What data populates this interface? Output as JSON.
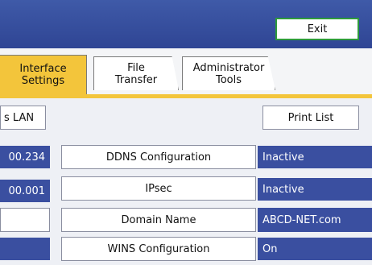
{
  "header": {
    "exit_label": "Exit"
  },
  "tabs": [
    {
      "label_line1": "Interface",
      "label_line2": "Settings"
    },
    {
      "label_line1": "File",
      "label_line2": "Transfer"
    },
    {
      "label_line1": "Administrator",
      "label_line2": "Tools"
    }
  ],
  "left_column": {
    "lan_button": "s LAN",
    "value1": "00.234",
    "value2": "00.001"
  },
  "print_list_label": "Print List",
  "rows": [
    {
      "label": "DDNS Configuration",
      "value": "Inactive"
    },
    {
      "label": "IPsec",
      "value": "Inactive"
    },
    {
      "label": "Domain Name",
      "value": "ABCD-NET.com"
    },
    {
      "label": "WINS Configuration",
      "value": "On"
    }
  ],
  "colors": {
    "accent": "#f3c53b",
    "header": "#2f4594",
    "value_bg": "#3a4fa0",
    "exit_border": "#2e9b3b"
  }
}
